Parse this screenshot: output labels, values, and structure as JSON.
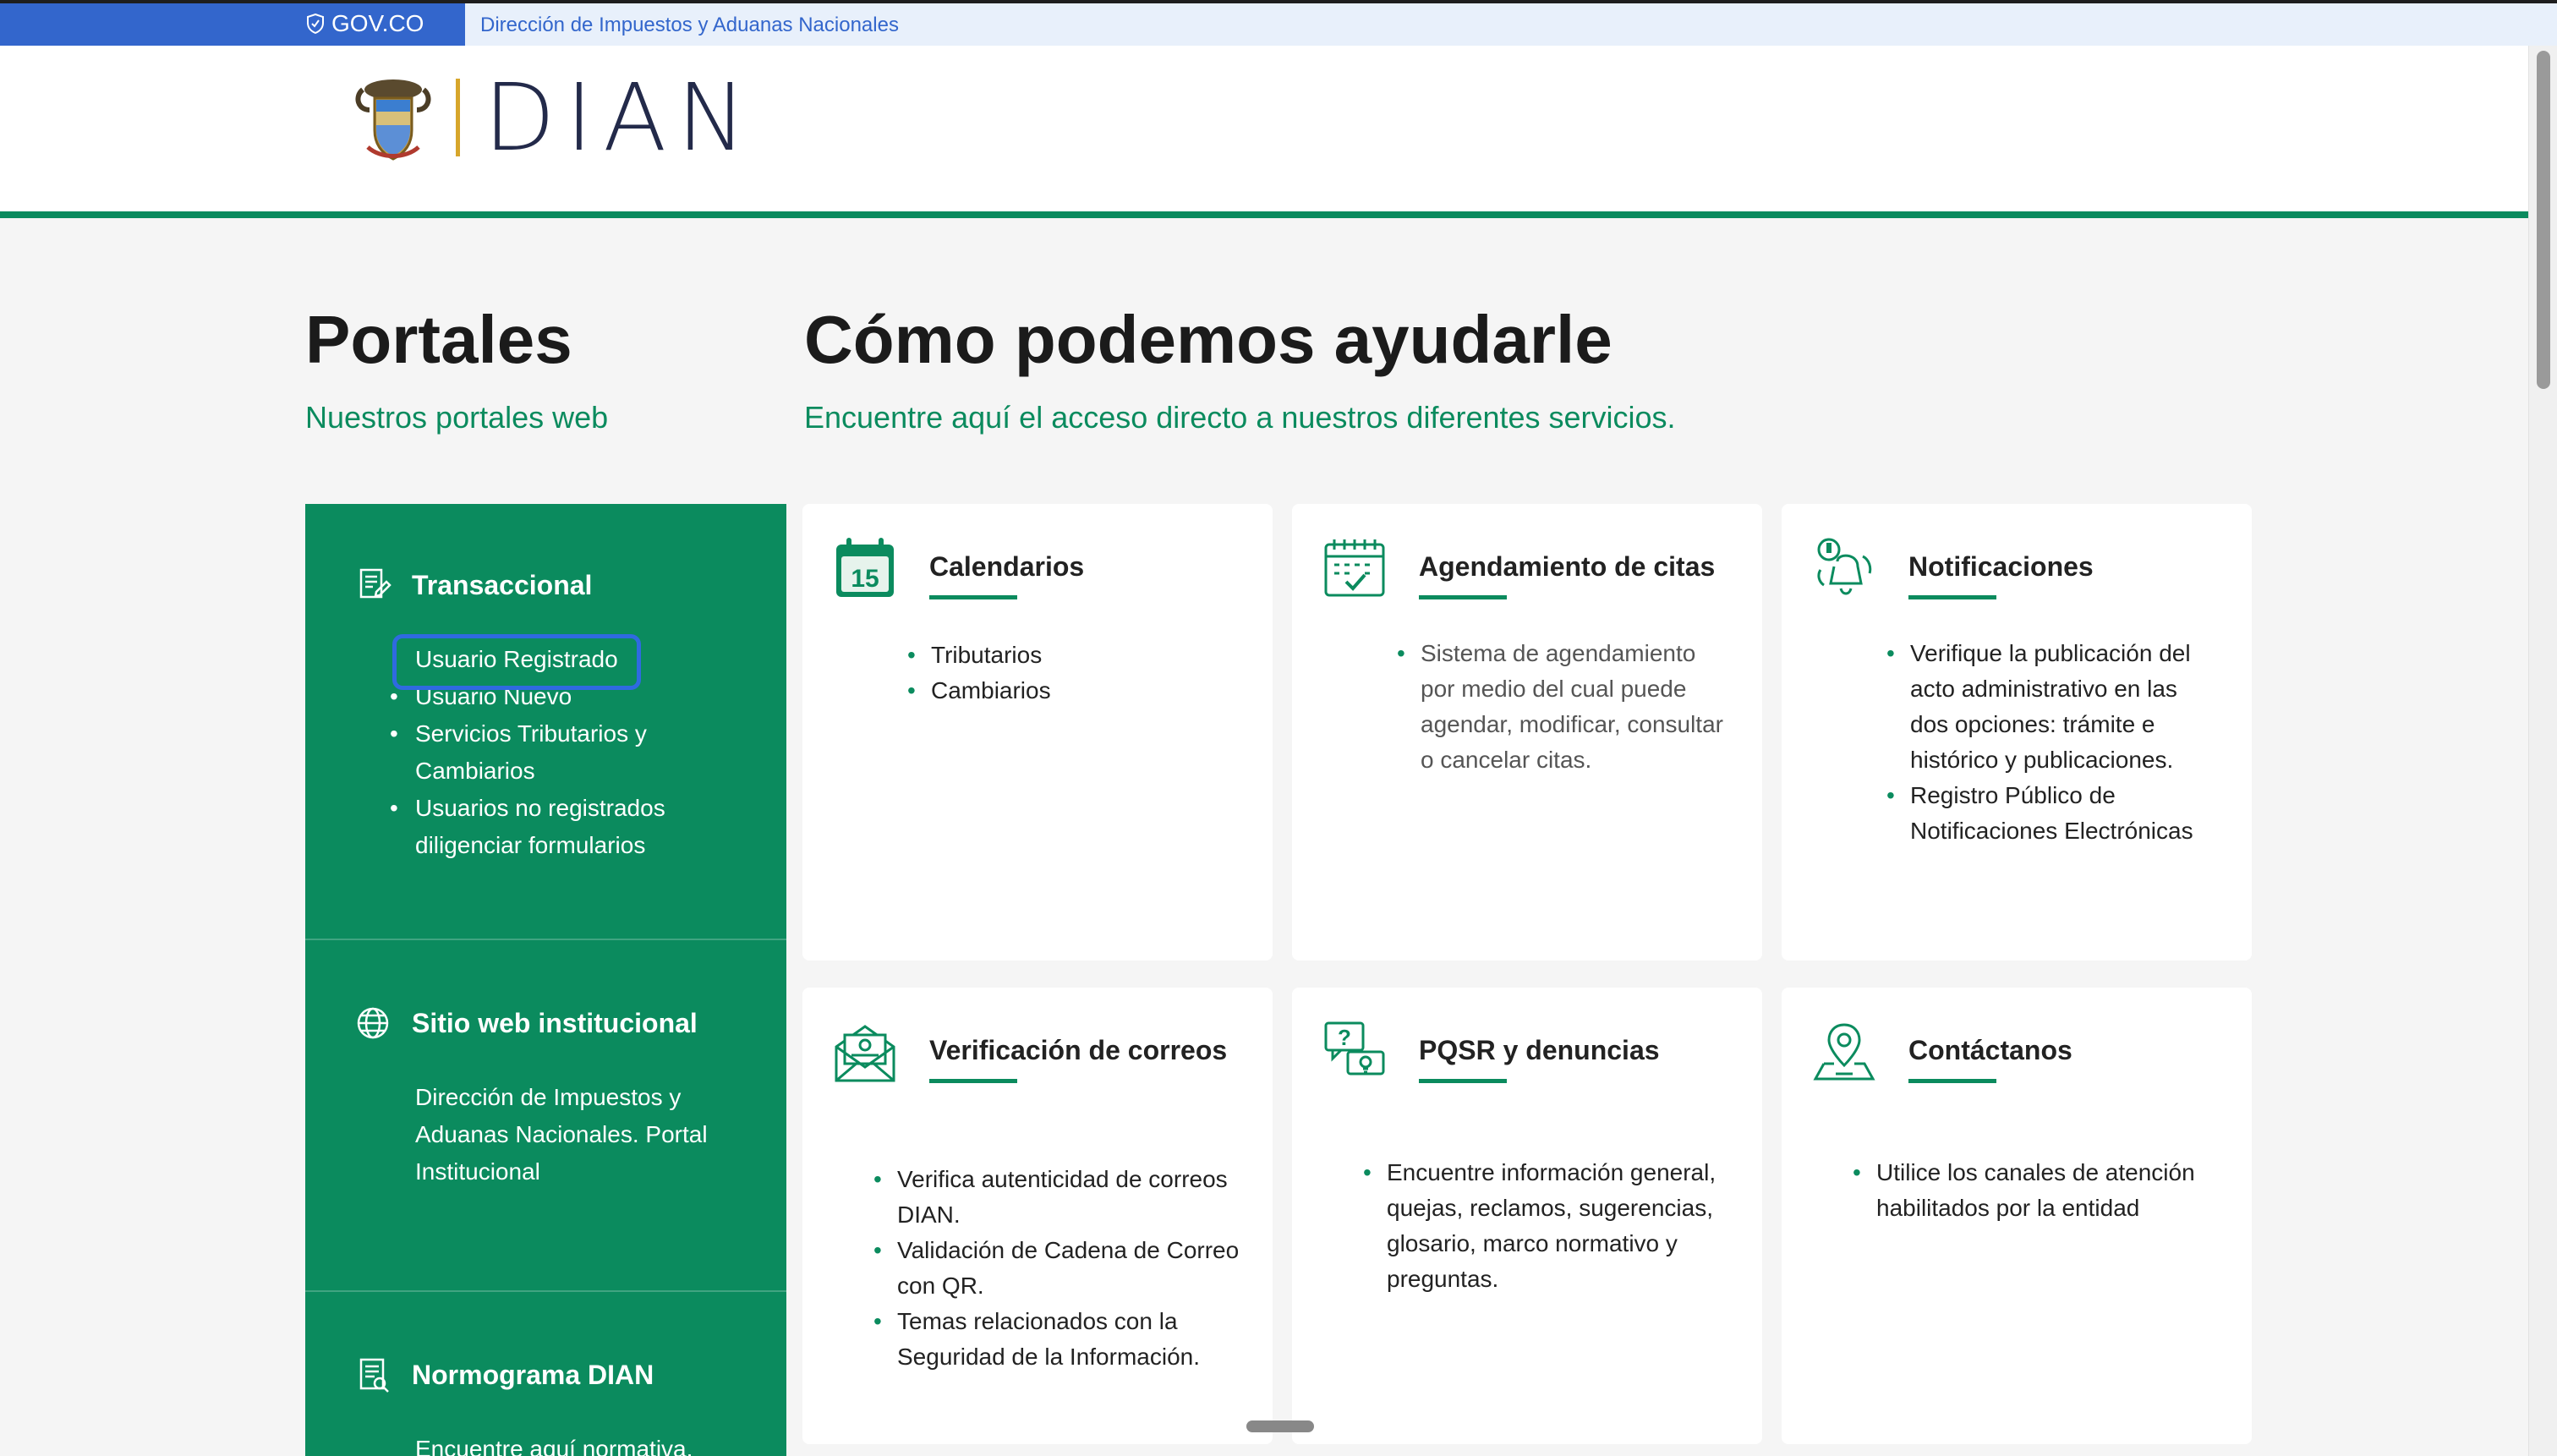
{
  "govbar": {
    "brand": "GOV.CO",
    "agency": "Dirección de Impuestos y Aduanas Nacionales"
  },
  "header": {
    "logo_text": "DIAN"
  },
  "portales": {
    "title": "Portales",
    "subtitle": "Nuestros portales web"
  },
  "ayuda": {
    "title": "Cómo podemos ayudarle",
    "subtitle": "Encuentre aquí el acceso directo a nuestros diferentes servicios."
  },
  "portals": [
    {
      "title": "Transaccional",
      "icon": "document-form-icon",
      "items": [
        "Usuario Registrado",
        "Usuario Nuevo",
        "Servicios Tributarios y",
        "Cambiarios",
        "Usuarios no registrados",
        "diligenciar formularios"
      ]
    },
    {
      "title": "Sitio web institucional",
      "icon": "globe-icon",
      "lines": [
        "Dirección de Impuestos y",
        "Aduanas Nacionales. Portal",
        "Institucional"
      ]
    },
    {
      "title": "Normograma DIAN",
      "icon": "legal-document-icon",
      "lines": [
        "Encuentre aquí normativa,"
      ]
    }
  ],
  "cards": [
    {
      "title": "Calendarios",
      "icon": "calendar-15-icon",
      "items": [
        "Tributarios",
        "Cambiarios"
      ]
    },
    {
      "title": "Agendamiento de citas",
      "icon": "calendar-check-icon",
      "items": [
        "Sistema de agendamiento",
        "por medio del cual puede",
        "agendar, modificar, consultar",
        "o cancelar citas."
      ]
    },
    {
      "title": "Notificaciones",
      "icon": "bell-notification-icon",
      "items": [
        "Verifique la publicación del",
        "acto administrativo en las",
        "dos opciones: trámite e",
        "histórico y publicaciones.",
        "Registro Público de",
        "Notificaciones Electrónicas"
      ]
    },
    {
      "title": "Verificación de correos",
      "icon": "mail-verify-icon",
      "items": [
        "Verifica autenticidad de correos",
        "DIAN.",
        "Validación de Cadena de Correo",
        "con QR.",
        "Temas relacionados con la",
        "Seguridad de la Información."
      ]
    },
    {
      "title": "PQSR y denuncias",
      "icon": "chat-question-icon",
      "items": [
        "Encuentre información general,",
        "quejas, reclamos, sugerencias,",
        "glosario, marco normativo y",
        "preguntas."
      ]
    },
    {
      "title": "Contáctanos",
      "icon": "location-pin-icon",
      "items": [
        "Utilice los canales de atención",
        "habilitados por la entidad"
      ]
    }
  ],
  "colors": {
    "green": "#0b8b5e",
    "gov_blue": "#3366cc",
    "highlight": "#2f6ae0"
  }
}
